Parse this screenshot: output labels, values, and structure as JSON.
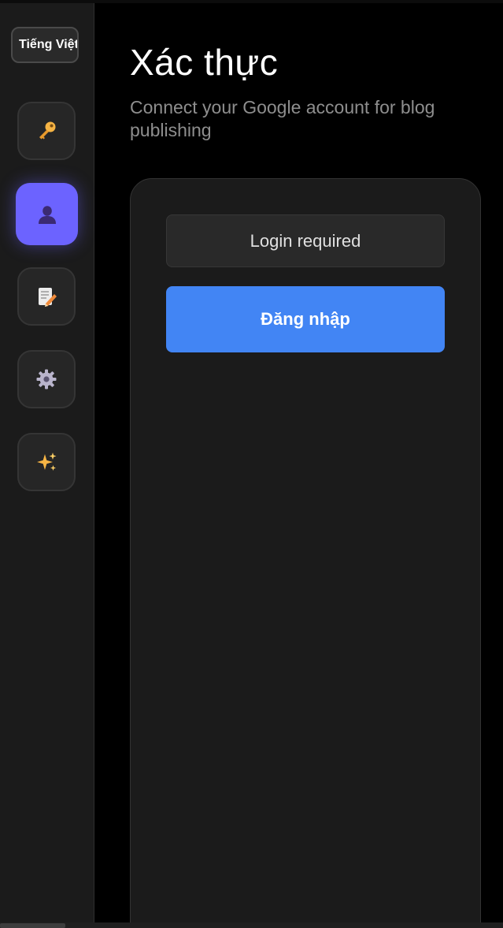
{
  "sidebar": {
    "language_label": "Tiếng Việt",
    "items": [
      {
        "name": "key",
        "icon": "key-icon"
      },
      {
        "name": "account",
        "icon": "user-silhouette-icon",
        "active": true
      },
      {
        "name": "posts",
        "icon": "memo-pencil-icon"
      },
      {
        "name": "settings",
        "icon": "gear-icon"
      },
      {
        "name": "ai",
        "icon": "sparkles-icon"
      }
    ]
  },
  "main": {
    "title": "Xác thực",
    "subtitle": "Connect your Google account for blog publishing",
    "card": {
      "status_text": "Login required",
      "login_label": "Đăng nhập"
    }
  },
  "colors": {
    "accent": "#6c63ff",
    "primary_button": "#4285f4",
    "background": "#000000",
    "panel": "#1b1b1b"
  }
}
